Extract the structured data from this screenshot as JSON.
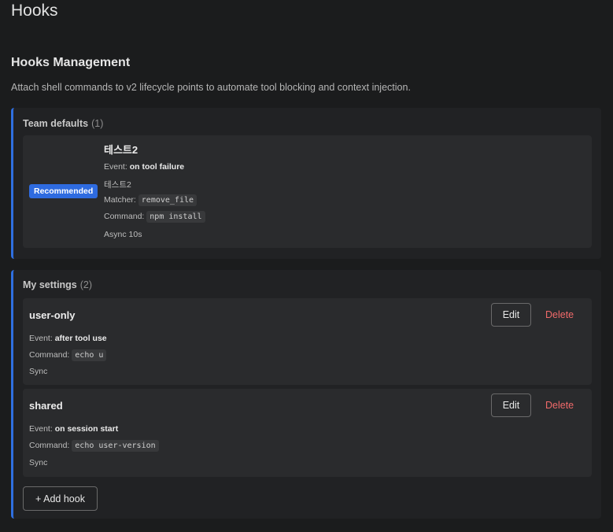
{
  "page": {
    "title": "Hooks"
  },
  "section": {
    "title": "Hooks Management",
    "description": "Attach shell commands to v2 lifecycle points to automate tool blocking and context injection."
  },
  "team_defaults": {
    "label": "Team defaults",
    "count": "(1)",
    "hooks": [
      {
        "badge": "Recommended",
        "name": "테스트2",
        "event_label": "Event:",
        "event": "on tool failure",
        "description": "테스트2",
        "matcher_label": "Matcher:",
        "matcher": "remove_file",
        "command_label": "Command:",
        "command": "npm install",
        "mode": "Async 10s"
      }
    ]
  },
  "my_settings": {
    "label": "My settings",
    "count": "(2)",
    "hooks": [
      {
        "name": "user-only",
        "event_label": "Event:",
        "event": "after tool use",
        "command_label": "Command:",
        "command": "echo u",
        "mode": "Sync",
        "edit_label": "Edit",
        "delete_label": "Delete"
      },
      {
        "name": "shared",
        "event_label": "Event:",
        "event": "on session start",
        "command_label": "Command:",
        "command": "echo user-version",
        "mode": "Sync",
        "edit_label": "Edit",
        "delete_label": "Delete"
      }
    ],
    "add_label": "+ Add hook"
  },
  "colors": {
    "accent": "#2f6fe0",
    "badge": "#2e6be0",
    "danger": "#f06a6a",
    "background": "#1b1c1d"
  }
}
